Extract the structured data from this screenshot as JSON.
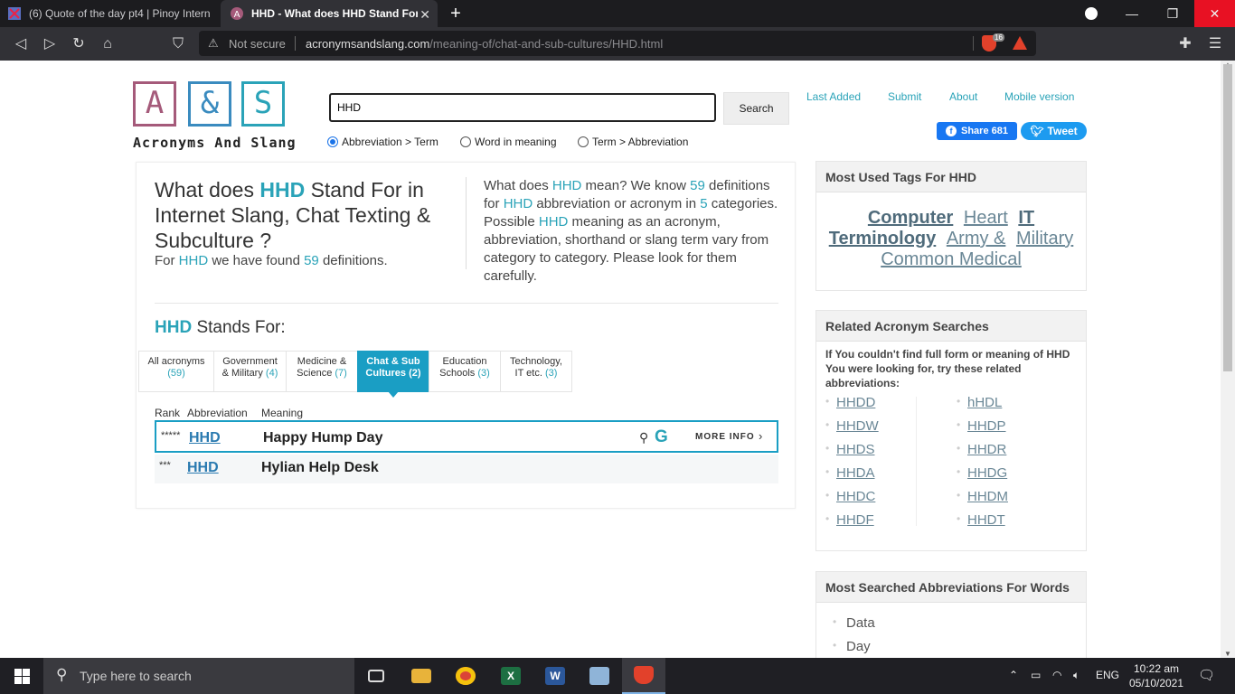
{
  "browser": {
    "tabs": [
      {
        "title": "(6) Quote of the day pt4 | Pinoy Intern",
        "active": false
      },
      {
        "title": "HHD - What does HHD Stand For",
        "active": true
      }
    ],
    "new_tab": "+",
    "security": "Not secure",
    "url_domain": "acronymsandslang.com",
    "url_path": "/meaning-of/chat-and-sub-cultures/HHD.html",
    "shield_count": "16"
  },
  "site": {
    "logo_letters": [
      "A",
      "&",
      "S"
    ],
    "logo_text": "Acronyms And Slang",
    "search_value": "HHD",
    "search_button": "Search",
    "search_modes": [
      "Abbreviation > Term",
      "Word in meaning",
      "Term > Abbreviation"
    ],
    "selected_mode": "Abbreviation > Term",
    "top_links": [
      "Last Added",
      "Submit",
      "About",
      "Mobile version"
    ],
    "share_label": "Share 681",
    "tweet_label": "Tweet"
  },
  "main": {
    "title_pre": "What does ",
    "term": "HHD",
    "title_post": " Stand For in Internet Slang, Chat Texting & Subculture ?",
    "found_pre": "For ",
    "found_mid": " we have found ",
    "found_count": "59",
    "found_post": " definitions.",
    "desc_1": "What does ",
    "desc_2": " mean? We know ",
    "desc_count": "59",
    "desc_3": " definitions for ",
    "desc_4": " abbreviation or acronym in ",
    "desc_categories": "5",
    "desc_5": " categories. Possible ",
    "desc_6": " meaning as an acronym, abbreviation, shorthand or slang term vary from category to category. Please look for them carefully.",
    "stands_for": " Stands For:",
    "categories": [
      {
        "line1": "All acronyms",
        "line2": "",
        "count": "(59)",
        "active": false
      },
      {
        "line1": "Government",
        "line2": "& Military",
        "count": "(4)",
        "active": false
      },
      {
        "line1": "Medicine &",
        "line2": "Science",
        "count": "(7)",
        "active": false
      },
      {
        "line1": "Chat & Sub",
        "line2": "Cultures",
        "count": "(2)",
        "active": true
      },
      {
        "line1": "Education",
        "line2": "Schools",
        "count": "(3)",
        "active": false
      },
      {
        "line1": "Technology,",
        "line2": "IT etc.",
        "count": "(3)",
        "active": false
      }
    ],
    "columns": [
      "Rank",
      "Abbreviation",
      "Meaning"
    ],
    "rows": [
      {
        "rank": "*****",
        "abbr": "HHD",
        "meaning": "Happy Hump Day"
      },
      {
        "rank": "***",
        "abbr": "HHD",
        "meaning": "Hylian Help Desk"
      }
    ],
    "more_info": "MORE INFO",
    "google_letter": "G"
  },
  "sidebar": {
    "tags_title": "Most Used Tags For HHD",
    "tags": [
      "Computer",
      "Heart",
      "IT",
      "Terminology",
      "Army &",
      "Military",
      "Common Medical"
    ],
    "related_title": "Related Acronym Searches",
    "related_intro": "If You couldn't find full form or meaning of HHD You were looking for, try these related abbreviations:",
    "related_left": [
      "HHDD",
      "HHDW",
      "HHDS",
      "HHDA",
      "HHDC",
      "HHDF"
    ],
    "related_right": [
      "hHDL",
      "HHDP",
      "HHDR",
      "HHDG",
      "HHDM",
      "HHDT"
    ],
    "most_title": "Most Searched Abbreviations For Words",
    "most_items": [
      "Data",
      "Day"
    ]
  },
  "taskbar": {
    "search_placeholder": "Type here to search",
    "language": "ENG",
    "time": "10:22 am",
    "date": "05/10/2021",
    "apps": [
      "task-view",
      "file-explorer",
      "chrome",
      "excel",
      "word",
      "notepad",
      "brave"
    ]
  }
}
